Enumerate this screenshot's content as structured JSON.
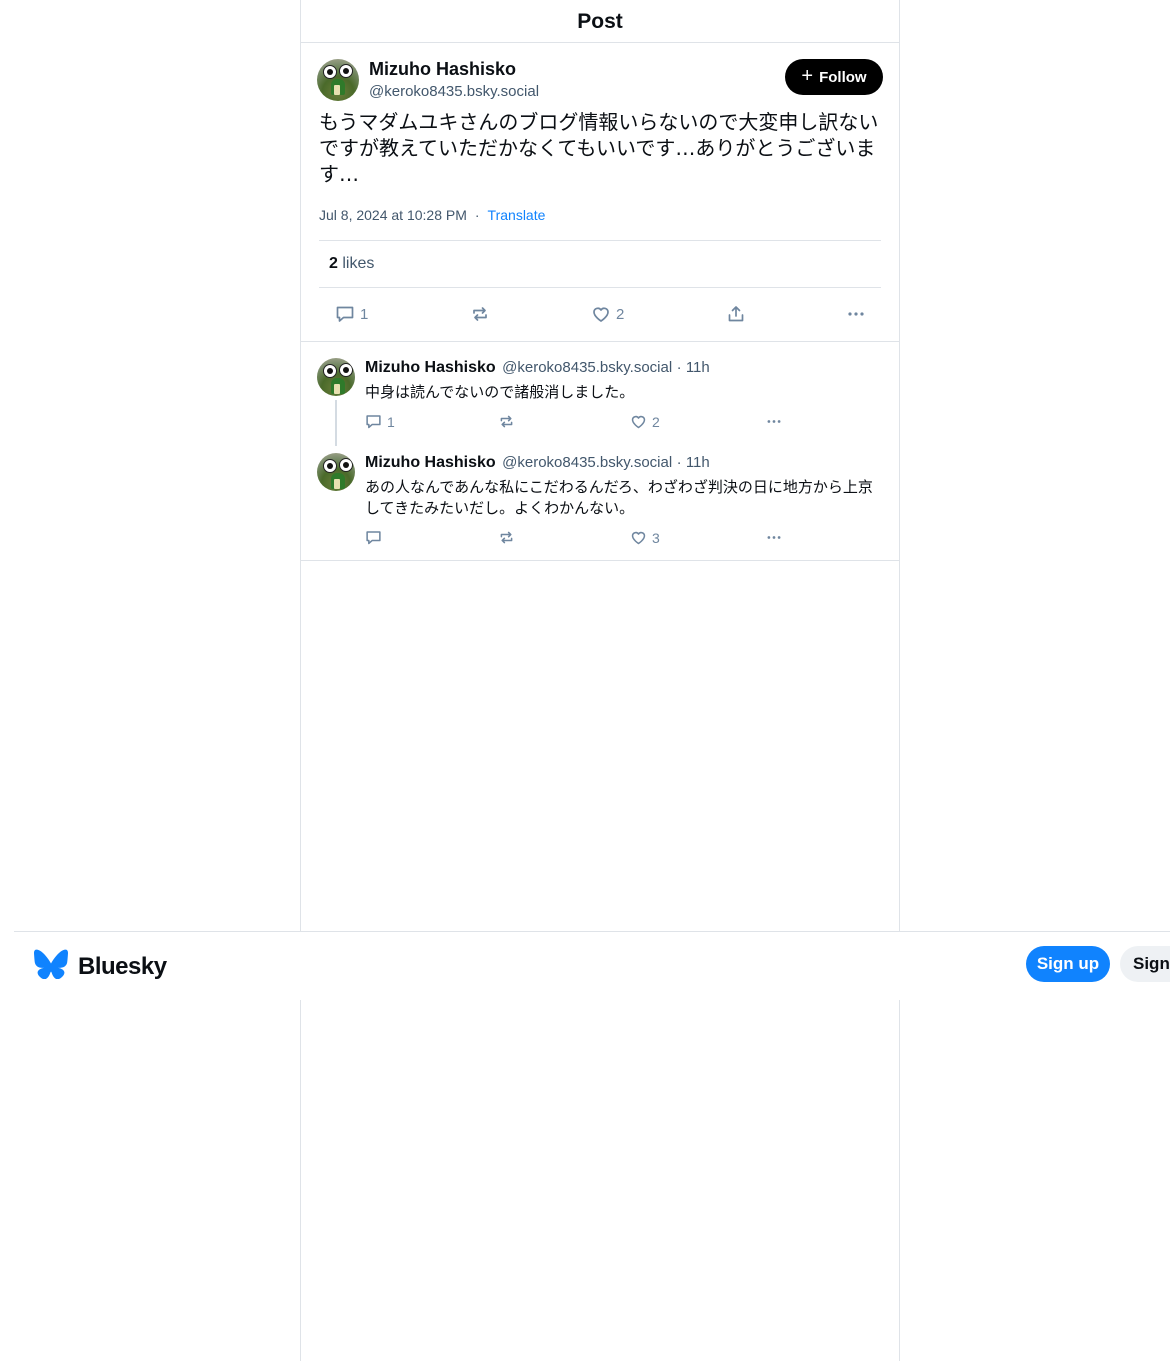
{
  "header": {
    "title": "Post"
  },
  "post": {
    "author_name": "Mizuho Hashisko",
    "author_handle": "@keroko8435.bsky.social",
    "follow_label": "Follow",
    "text": "もうマダムユキさんのブログ情報いらないので大変申し訳ないですが教えていただかなくてもいいです…ありがとうございます…",
    "timestamp": "Jul 8, 2024 at 10:28 PM",
    "translate_label": "Translate",
    "likes_count": "2",
    "likes_label": "likes",
    "reply_count": "1",
    "like_count": "2"
  },
  "replies": [
    {
      "author_name": "Mizuho Hashisko",
      "author_handle": "@keroko8435.bsky.social",
      "time": "11h",
      "text": "中身は読んでないので諸般消しました。",
      "reply_count": "1",
      "like_count": "2"
    },
    {
      "author_name": "Mizuho Hashisko",
      "author_handle": "@keroko8435.bsky.social",
      "time": "11h",
      "text": "あの人なんであんな私にこだわるんだろ、わざわざ判決の日に地方から上京してきたみたいだし。よくわかんない。",
      "reply_count": "",
      "like_count": "3"
    }
  ],
  "footer": {
    "brand": "Bluesky",
    "signup_label": "Sign up",
    "signin_label": "Sign in"
  },
  "colors": {
    "accent": "#1083fe",
    "text_muted": "#42576c",
    "icon": "#6f869f",
    "border": "#dfe3e8"
  }
}
